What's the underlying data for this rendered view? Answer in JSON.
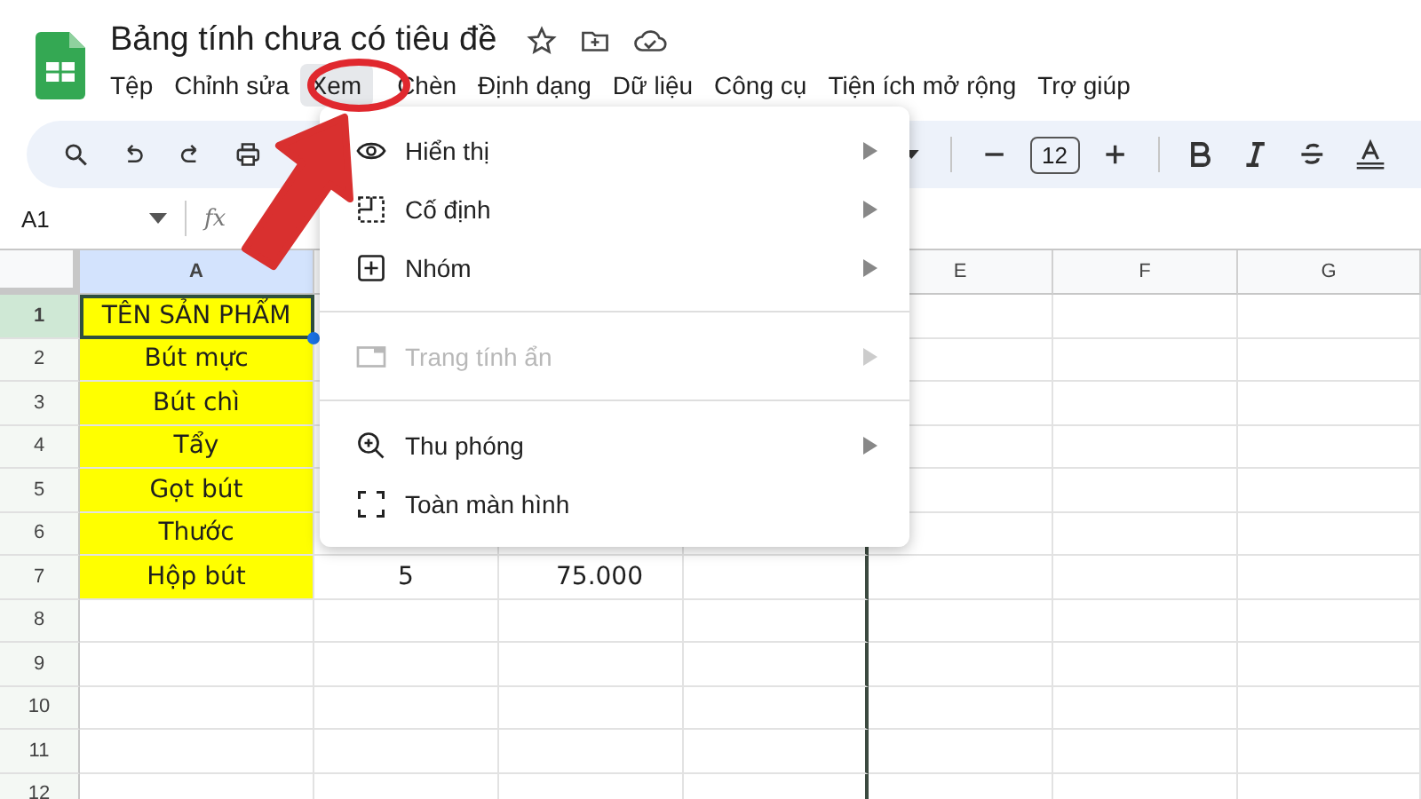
{
  "title": "Bảng tính chưa có tiêu đề",
  "menubar": [
    {
      "label": "Tệp",
      "selected": false
    },
    {
      "label": "Chỉnh sửa",
      "selected": false
    },
    {
      "label": "Xem",
      "selected": true
    },
    {
      "label": "Chèn",
      "selected": false
    },
    {
      "label": "Định dạng",
      "selected": false
    },
    {
      "label": "Dữ liệu",
      "selected": false
    },
    {
      "label": "Công cụ",
      "selected": false
    },
    {
      "label": "Tiện ích mở rộng",
      "selected": false
    },
    {
      "label": "Trợ giúp",
      "selected": false
    }
  ],
  "toolbar": {
    "font_size": "12"
  },
  "name_box": "A1",
  "formula_label": "fx",
  "grid": {
    "columns": [
      {
        "label": "A",
        "selected": true
      },
      {},
      {},
      {},
      {
        "label": "E",
        "selected": false
      },
      {
        "label": "F",
        "selected": false
      },
      {
        "label": "G",
        "selected": false
      }
    ],
    "rows": [
      {
        "label": "1",
        "selected": true,
        "cells": [
          "TÊN SẢN PHẨM",
          "",
          ""
        ]
      },
      {
        "label": "2",
        "selected": false,
        "cells": [
          "Bút mực",
          "",
          ""
        ]
      },
      {
        "label": "3",
        "selected": false,
        "cells": [
          "Bút chì",
          "",
          ""
        ]
      },
      {
        "label": "4",
        "selected": false,
        "cells": [
          "Tẩy",
          "",
          ""
        ]
      },
      {
        "label": "5",
        "selected": false,
        "cells": [
          "Gọt bút",
          "",
          ""
        ]
      },
      {
        "label": "6",
        "selected": false,
        "cells": [
          "Thước",
          "",
          ""
        ]
      },
      {
        "label": "7",
        "selected": false,
        "cells": [
          "Hộp bút",
          "5",
          "75.000"
        ]
      },
      {
        "label": "8",
        "selected": false,
        "cells": [
          "",
          "",
          ""
        ]
      },
      {
        "label": "9",
        "selected": false,
        "cells": [
          "",
          "",
          ""
        ]
      },
      {
        "label": "10",
        "selected": false,
        "cells": [
          "",
          "",
          ""
        ]
      },
      {
        "label": "11",
        "selected": false,
        "cells": [
          "",
          "",
          ""
        ]
      },
      {
        "label": "12",
        "selected": false,
        "cells": [
          "",
          "",
          ""
        ]
      }
    ]
  },
  "dropdown_menu": [
    {
      "kind": "item",
      "label": "Hiển thị",
      "submenu": true,
      "disabled": false
    },
    {
      "kind": "item",
      "label": "Cố định",
      "submenu": true,
      "disabled": false
    },
    {
      "kind": "item",
      "label": "Nhóm",
      "submenu": true,
      "disabled": false
    },
    {
      "kind": "divider"
    },
    {
      "kind": "item",
      "label": "Trang tính ẩn",
      "submenu": true,
      "disabled": true
    },
    {
      "kind": "divider"
    },
    {
      "kind": "item",
      "label": "Thu phóng",
      "submenu": true,
      "disabled": false
    },
    {
      "kind": "item",
      "label": "Toàn màn hình",
      "submenu": false,
      "disabled": false
    }
  ]
}
